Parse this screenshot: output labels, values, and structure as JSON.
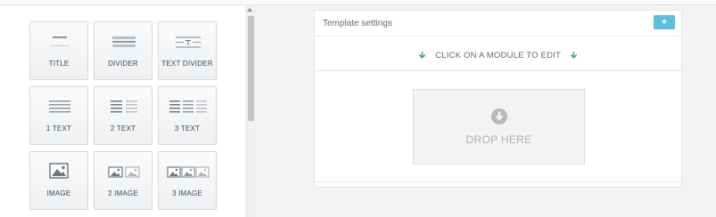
{
  "modules": [
    {
      "label": "TITLE",
      "icon": "title-icon"
    },
    {
      "label": "DIVIDER",
      "icon": "divider-icon"
    },
    {
      "label": "TEXT DIVIDER",
      "icon": "text-divider-icon"
    },
    {
      "label": "1 TEXT",
      "icon": "one-text-icon"
    },
    {
      "label": "2 TEXT",
      "icon": "two-text-icon"
    },
    {
      "label": "3 TEXT",
      "icon": "three-text-icon"
    },
    {
      "label": "IMAGE",
      "icon": "image-icon"
    },
    {
      "label": "2 IMAGE",
      "icon": "two-image-icon"
    },
    {
      "label": "3 IMAGE",
      "icon": "three-image-icon"
    }
  ],
  "editor": {
    "template_settings": "Template settings",
    "add_label": "+",
    "hint": "CLICK ON A MODULE TO EDIT",
    "drop_label": "DROP HERE"
  },
  "colors": {
    "accent": "#5bc0de",
    "hint_arrow": "#3fb06b"
  }
}
